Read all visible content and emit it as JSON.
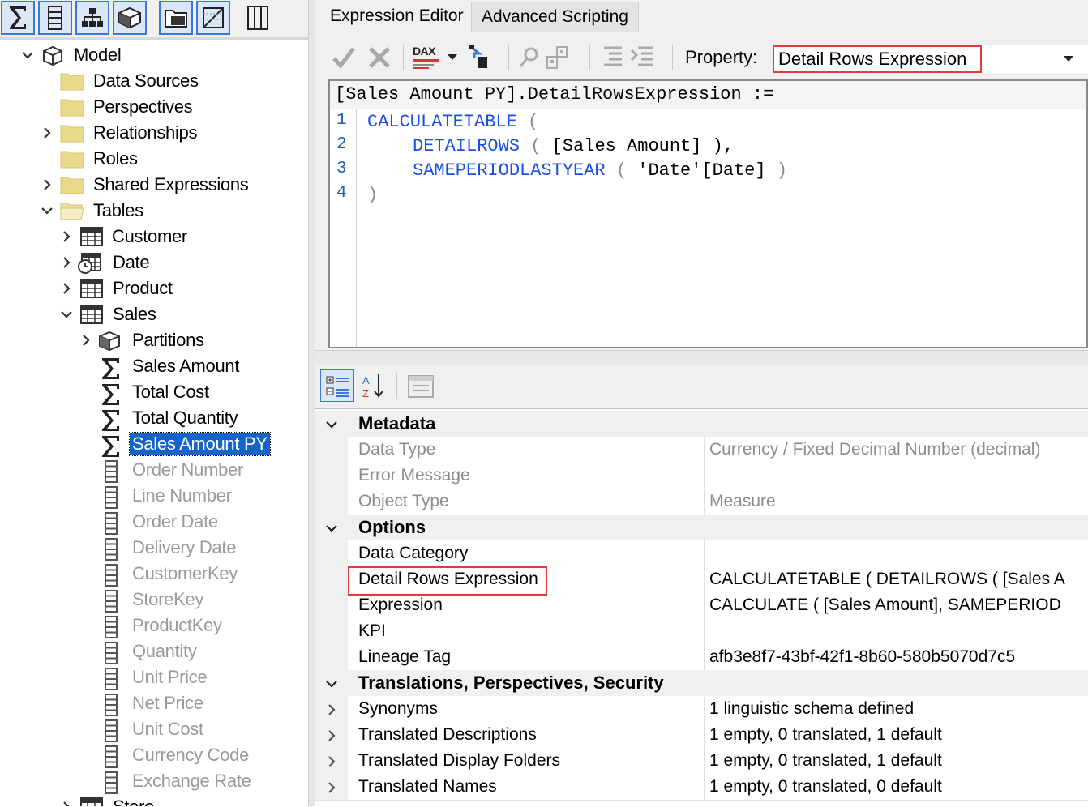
{
  "left_toolbar": {
    "icons": [
      "sigma-icon",
      "column-icon",
      "hierarchy-icon",
      "cube-icon",
      "folder-icon",
      "calc-table-icon",
      "table-grid-icon"
    ]
  },
  "tree": {
    "items": [
      {
        "label": "Model",
        "icon": "model-icon"
      },
      {
        "label": "Data Sources",
        "icon": "folder-icon"
      },
      {
        "label": "Perspectives",
        "icon": "folder-icon"
      },
      {
        "label": "Relationships",
        "icon": "folder-icon"
      },
      {
        "label": "Roles",
        "icon": "folder-icon"
      },
      {
        "label": "Shared Expressions",
        "icon": "folder-icon"
      },
      {
        "label": "Tables",
        "icon": "folder-open-icon"
      },
      {
        "label": "Customer",
        "icon": "table-icon"
      },
      {
        "label": "Date",
        "icon": "date-table-icon"
      },
      {
        "label": "Product",
        "icon": "table-icon"
      },
      {
        "label": "Sales",
        "icon": "table-icon"
      },
      {
        "label": "Partitions",
        "icon": "partitions-icon"
      },
      {
        "label": "Sales Amount",
        "icon": "sigma-icon"
      },
      {
        "label": "Total Cost",
        "icon": "sigma-icon"
      },
      {
        "label": "Total Quantity",
        "icon": "sigma-icon"
      },
      {
        "label": "Sales Amount PY",
        "icon": "sigma-icon"
      },
      {
        "label": "Order Number",
        "icon": "column-icon"
      },
      {
        "label": "Line Number",
        "icon": "column-icon"
      },
      {
        "label": "Order Date",
        "icon": "column-icon"
      },
      {
        "label": "Delivery Date",
        "icon": "column-icon"
      },
      {
        "label": "CustomerKey",
        "icon": "column-icon"
      },
      {
        "label": "StoreKey",
        "icon": "column-icon"
      },
      {
        "label": "ProductKey",
        "icon": "column-icon"
      },
      {
        "label": "Quantity",
        "icon": "column-icon"
      },
      {
        "label": "Unit Price",
        "icon": "column-icon"
      },
      {
        "label": "Net Price",
        "icon": "column-icon"
      },
      {
        "label": "Unit Cost",
        "icon": "column-icon"
      },
      {
        "label": "Currency Code",
        "icon": "column-icon"
      },
      {
        "label": "Exchange Rate",
        "icon": "column-icon"
      },
      {
        "label": "Store",
        "icon": "table-icon"
      }
    ]
  },
  "tabs": [
    {
      "label": "Expression Editor",
      "active": true
    },
    {
      "label": "Advanced Scripting",
      "active": false
    }
  ],
  "expr_toolbar": {
    "dax_label": "DAX",
    "property_label": "Property:",
    "property_value": "Detail Rows Expression"
  },
  "editor": {
    "header": "[Sales Amount PY].DetailRowsExpression :=",
    "line_numbers": [
      "1",
      "2",
      "3",
      "4"
    ],
    "lines": {
      "l1_fn": "CALCULATETABLE",
      "l1_par": " (",
      "l2_fn": "DETAILROWS",
      "l2_par": " ( ",
      "l2_arg": "[Sales Amount]",
      "l2_end": " ),",
      "l3_fn": "SAMEPERIODLASTYEAR",
      "l3_par": " ( ",
      "l3_arg": "'Date'[Date]",
      "l3_end": " )",
      "l4": ")"
    }
  },
  "property_grid": {
    "categories": {
      "metadata": "Metadata",
      "options": "Options",
      "translations": "Translations, Perspectives, Security"
    },
    "rows": {
      "data_type": {
        "name": "Data Type",
        "value": "Currency / Fixed Decimal Number (decimal)"
      },
      "error_message": {
        "name": "Error Message",
        "value": ""
      },
      "object_type": {
        "name": "Object Type",
        "value": "Measure"
      },
      "data_category": {
        "name": "Data Category",
        "value": ""
      },
      "detail_rows": {
        "name": "Detail Rows Expression",
        "value": "CALCULATETABLE (    DETAILROWS ( [Sales A"
      },
      "expression": {
        "name": "Expression",
        "value": "CALCULATE (    [Sales Amount],    SAMEPERIOD"
      },
      "kpi": {
        "name": "KPI",
        "value": ""
      },
      "lineage_tag": {
        "name": "Lineage Tag",
        "value": "afb3e8f7-43bf-42f1-8b60-580b5070d7c5"
      },
      "synonyms": {
        "name": "Synonyms",
        "value": "1 linguistic schema defined"
      },
      "translated_descriptions": {
        "name": "Translated Descriptions",
        "value": "1 empty, 0 translated, 1 default"
      },
      "translated_display_folders": {
        "name": "Translated Display Folders",
        "value": "1 empty, 0 translated, 1 default"
      },
      "translated_names": {
        "name": "Translated Names",
        "value": "1 empty, 0 translated, 0 default"
      }
    }
  },
  "colors": {
    "selection": "#1565c8",
    "keyword": "#1a4fe0",
    "highlight_box": "#e03c3c",
    "dim_text": "#9a9a9a"
  }
}
